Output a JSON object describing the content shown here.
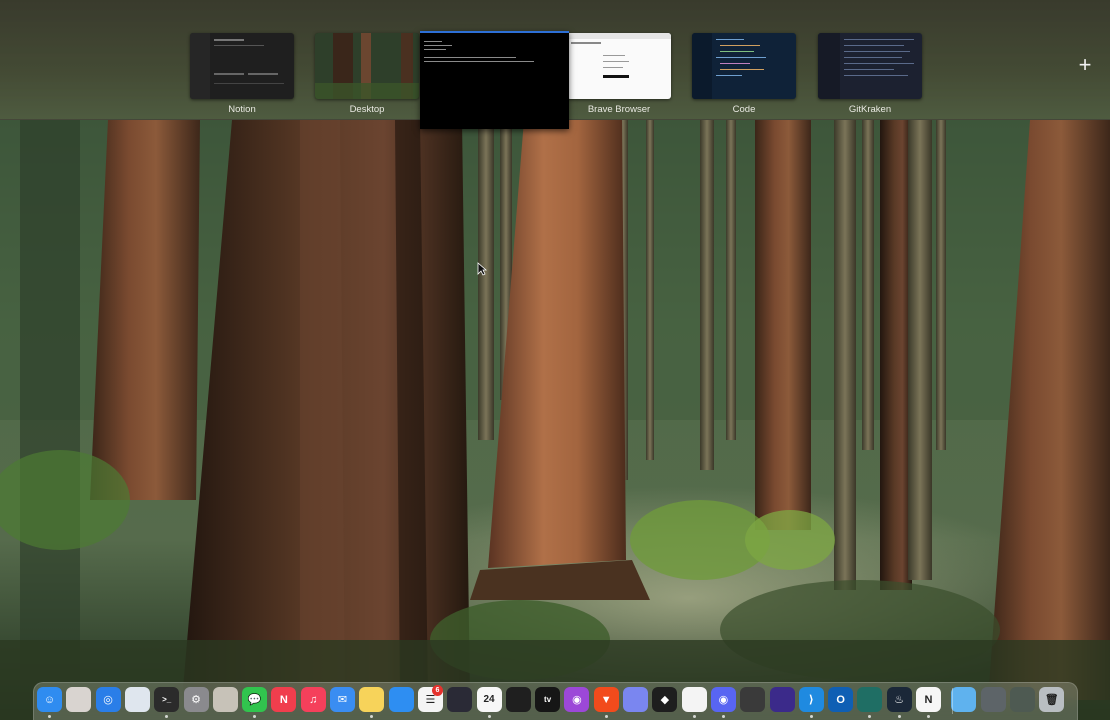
{
  "mission_control": {
    "spaces": [
      {
        "label": "Notion",
        "icon": "notion-window-thumbnail"
      },
      {
        "label": "Desktop",
        "icon": "desktop-thumbnail"
      },
      {
        "label": "",
        "icon": "terminal-window-thumbnail"
      },
      {
        "label": "Brave Browser",
        "icon": "brave-window-thumbnail"
      },
      {
        "label": "Code",
        "icon": "vscode-window-thumbnail"
      },
      {
        "label": "GitKraken",
        "icon": "gitkraken-window-thumbnail"
      }
    ],
    "add_space_glyph": "+"
  },
  "dock": {
    "items": [
      {
        "app": "Finder",
        "icon": "finder-icon",
        "color": "#2f8cf0"
      },
      {
        "app": "Launchpad",
        "icon": "launchpad-icon",
        "color": "#d9d4d0"
      },
      {
        "app": "Safari",
        "icon": "safari-icon",
        "color": "#2a7ee8"
      },
      {
        "app": "Preview",
        "icon": "preview-icon",
        "color": "#dfe6ee"
      },
      {
        "app": "Terminal",
        "icon": "terminal-icon",
        "color": "#2b2b2b"
      },
      {
        "app": "System Settings",
        "icon": "settings-gear-icon",
        "color": "#8a8a8e"
      },
      {
        "app": "Maps",
        "icon": "maps-icon",
        "color": "#c7c2b8"
      },
      {
        "app": "Messages",
        "icon": "messages-icon",
        "color": "#31c44e"
      },
      {
        "app": "News",
        "icon": "news-icon",
        "color": "#f03e4d"
      },
      {
        "app": "Music",
        "icon": "music-icon",
        "color": "#f5405b"
      },
      {
        "app": "Mail",
        "icon": "mail-icon",
        "color": "#3a8df2"
      },
      {
        "app": "Notes",
        "icon": "notes-icon",
        "color": "#f7d35a"
      },
      {
        "app": "App Store",
        "icon": "app-store-icon",
        "color": "#2e8ef2"
      },
      {
        "app": "Reminders",
        "icon": "reminders-icon",
        "color": "#f4f4f4"
      },
      {
        "app": "Podcasts Cast",
        "icon": "wallet-icon",
        "color": "#2a2a36"
      },
      {
        "app": "Calendar",
        "icon": "calendar-icon",
        "color": "#f7f7f7"
      },
      {
        "app": "Screenshot",
        "icon": "screenshot-icon",
        "color": "#1f1f1f"
      },
      {
        "app": "TV",
        "icon": "apple-tv-icon",
        "color": "#161616"
      },
      {
        "app": "Podcasts",
        "icon": "podcasts-icon",
        "color": "#9c48d8"
      },
      {
        "app": "Brave",
        "icon": "brave-icon",
        "color": "#f24b1c"
      },
      {
        "app": "ChatGPT",
        "icon": "chatgpt-icon",
        "color": "#7a86f0"
      },
      {
        "app": "Figma",
        "icon": "figma-icon",
        "color": "#1e1e1e"
      },
      {
        "app": "Slack",
        "icon": "slack-icon",
        "color": "#f4f4f4"
      },
      {
        "app": "Discord",
        "icon": "discord-icon",
        "color": "#5865f2"
      },
      {
        "app": "Simulator",
        "icon": "simulator-icon",
        "color": "#3a3a3a"
      },
      {
        "app": "Arc",
        "icon": "circle-app-icon",
        "color": "#3b2a8a"
      },
      {
        "app": "VS Code",
        "icon": "vscode-icon",
        "color": "#1f8ae0"
      },
      {
        "app": "Outlook",
        "icon": "outlook-icon",
        "color": "#0f5fb4"
      },
      {
        "app": "GitKraken",
        "icon": "gitkraken-icon",
        "color": "#1f6e64"
      },
      {
        "app": "Steam",
        "icon": "steam-icon",
        "color": "#1b2838"
      },
      {
        "app": "Notion",
        "icon": "notion-icon",
        "color": "#f6f6f6"
      },
      {
        "app": "Downloads",
        "icon": "downloads-folder-icon",
        "color": "#5fb2ee"
      },
      {
        "app": "Recent Window",
        "icon": "window-stack-icon",
        "color": "#5d6468"
      },
      {
        "app": "Documents Stack",
        "icon": "documents-stack-icon",
        "color": "#4e5a52"
      },
      {
        "app": "Trash",
        "icon": "trash-icon",
        "color": "#b9bec2"
      }
    ],
    "glyphs": {
      "messages": "💬",
      "news": "N",
      "music": "♫",
      "mail": "✉",
      "reminders": "☰",
      "calendar": "24",
      "tv": "tv",
      "notion": "N",
      "steam": "♨",
      "discord": "◉",
      "vscode": "⟩",
      "outlook": "O",
      "figma": "◆",
      "finder": "☺",
      "safari": "◎",
      "settings": "⚙",
      "terminal": ">_",
      "podcasts": "◉",
      "brave": "▼",
      "trash": "🗑"
    },
    "reminders_badge": "6",
    "colors": {
      "accent": "#2d6fd6",
      "badge": "#e5322d"
    }
  }
}
